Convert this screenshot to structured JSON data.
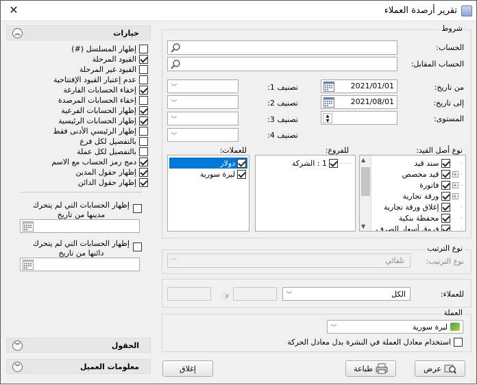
{
  "window": {
    "title": "تقرير أرصدة العملاء",
    "close_glyph": "✕"
  },
  "side": {
    "options_title": "خيارات",
    "options": [
      {
        "label": "إظهار المسلسل (#)",
        "checked": false
      },
      {
        "label": "القيود المرحلة",
        "checked": true
      },
      {
        "label": "القيود غير المرحلة",
        "checked": false
      },
      {
        "label": "عدم إعتبار القيود الإفتتاحية",
        "checked": false
      },
      {
        "label": "إخفاء الحسابات الفارغة",
        "checked": true
      },
      {
        "label": "إخفاء الحسابات المرصدة",
        "checked": false
      },
      {
        "label": "إظهار الحسابات الفرعية",
        "checked": true
      },
      {
        "label": "إظهار الحسابات الرئيسية",
        "checked": true
      },
      {
        "label": "إظهار  الرئيسي الأدنى فقط",
        "checked": false
      },
      {
        "label": "بالتفصيل لكل فرع",
        "checked": false
      },
      {
        "label": "بالتفصيل لكل عملة",
        "checked": false
      },
      {
        "label": "دمج رمز الحساب مع الاسم",
        "checked": true
      },
      {
        "label": "إظهار حقول المدين",
        "checked": true
      },
      {
        "label": "إظهار حقول الدائن",
        "checked": true
      }
    ],
    "debit_no_move": {
      "line1": "إظهار الحسابات التي لم يتحرك",
      "line2": "مدينها من تاريخ"
    },
    "credit_no_move": {
      "line1": "إظهار الحسابات التي لم يتحرك",
      "line2": "دائنها من تاريخ"
    },
    "fields_title": "الحقول",
    "customer_info_title": "معلومات العميل"
  },
  "conditions": {
    "title": "شروط",
    "account_label": "الحساب:",
    "counter_account_label": "الحساب المقابل:",
    "from_date_label": "من تاريخ:",
    "from_date": "2021/01/01",
    "to_date_label": "إلى تاريخ:",
    "to_date": "2021/08/01",
    "level_label": "المستوى:",
    "class1_label": "تصنيف 1:",
    "class2_label": "تصنيف 2:",
    "class3_label": "تصنيف 3:",
    "class4_label": "تصنيف 4:",
    "origin_type_label": "نوع أصل القيد:",
    "origin_types": [
      {
        "label": "سند قيد",
        "checked": true
      },
      {
        "label": "قيد مخصص",
        "checked": true
      },
      {
        "label": "فاتورة",
        "checked": true
      },
      {
        "label": "ورقة تجارية",
        "checked": true
      },
      {
        "label": "إغلاق ورقة تجارية",
        "checked": true
      },
      {
        "label": "محفظة بنكية",
        "checked": true
      },
      {
        "label": "فروق أسعار الصرف",
        "checked": true
      }
    ],
    "branches_label": "للفروع:",
    "branches": [
      {
        "label": "1 : الشركة",
        "checked": true
      }
    ],
    "currencies_label": "للعملات:",
    "currencies": [
      {
        "label": "دولار",
        "checked": true,
        "selected": true
      },
      {
        "label": "ليرة سورية",
        "checked": true,
        "selected": false
      }
    ]
  },
  "sorting": {
    "title": "نوع الترتيب",
    "label": "نوع الترتيب:",
    "value": "تلقائي"
  },
  "customers": {
    "label": "للعملاء:",
    "value": "الكل",
    "sep": "و:"
  },
  "currency": {
    "title": "العملة",
    "value": "ليرة سورية",
    "use_rate_label": "استخدام معادل العملة في النشرة بدل معادل الحركة",
    "use_rate_checked": false
  },
  "buttons": {
    "show": "عرض",
    "print": "طباعة",
    "close": "إغلاق"
  }
}
